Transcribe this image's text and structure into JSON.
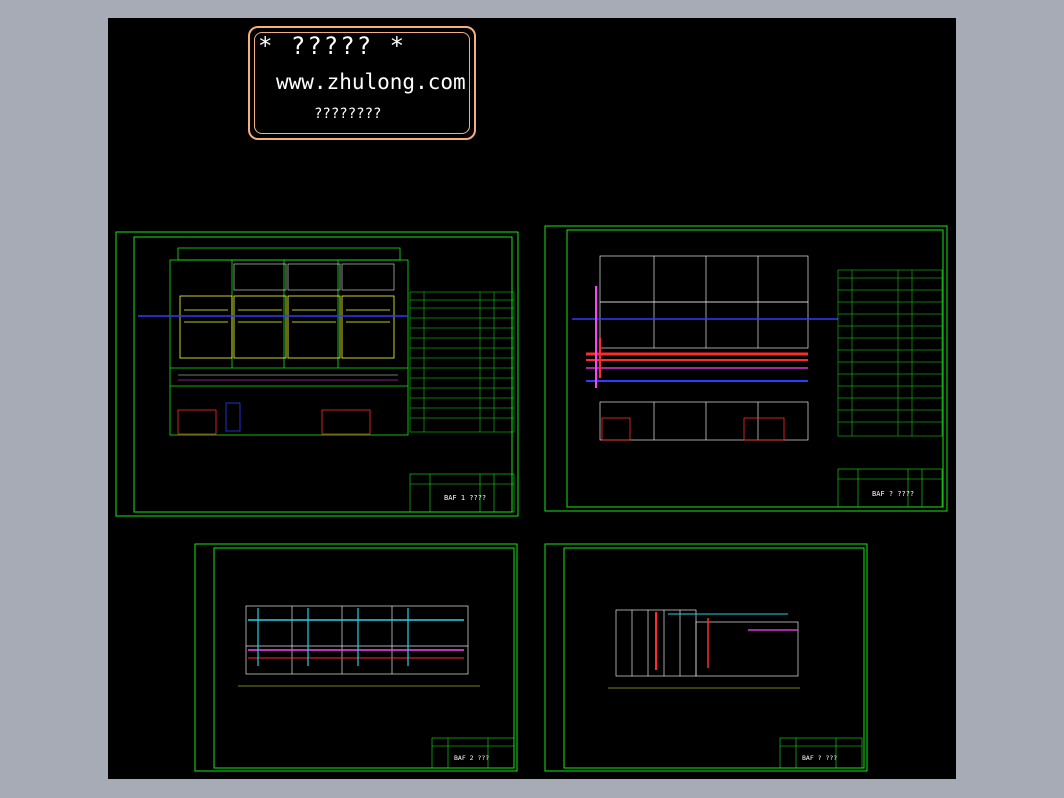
{
  "app": {
    "background_color": "#a7abb6",
    "canvas_color": "#000000"
  },
  "stamp": {
    "line1": "* ????? *",
    "line2": "www.zhulong.com",
    "line3": "????????",
    "border_color": "#f3b07e"
  },
  "colors": {
    "frame": "#19e619",
    "pipe_red": "#ff2a2a",
    "pipe_magenta": "#ff40ff",
    "pipe_blue": "#2e3cff",
    "pipe_cyan": "#22d3e6",
    "pipe_yellow": "#ffff30",
    "wall": "#e6e6e6"
  },
  "sheets": [
    {
      "id": "sheet-1",
      "title_code": "BAF 1 ????"
    },
    {
      "id": "sheet-2",
      "title_code": "BAF ? ????"
    },
    {
      "id": "sheet-3",
      "title_code": "BAF 2 ???"
    },
    {
      "id": "sheet-4",
      "title_code": "BAF ? ???"
    }
  ]
}
